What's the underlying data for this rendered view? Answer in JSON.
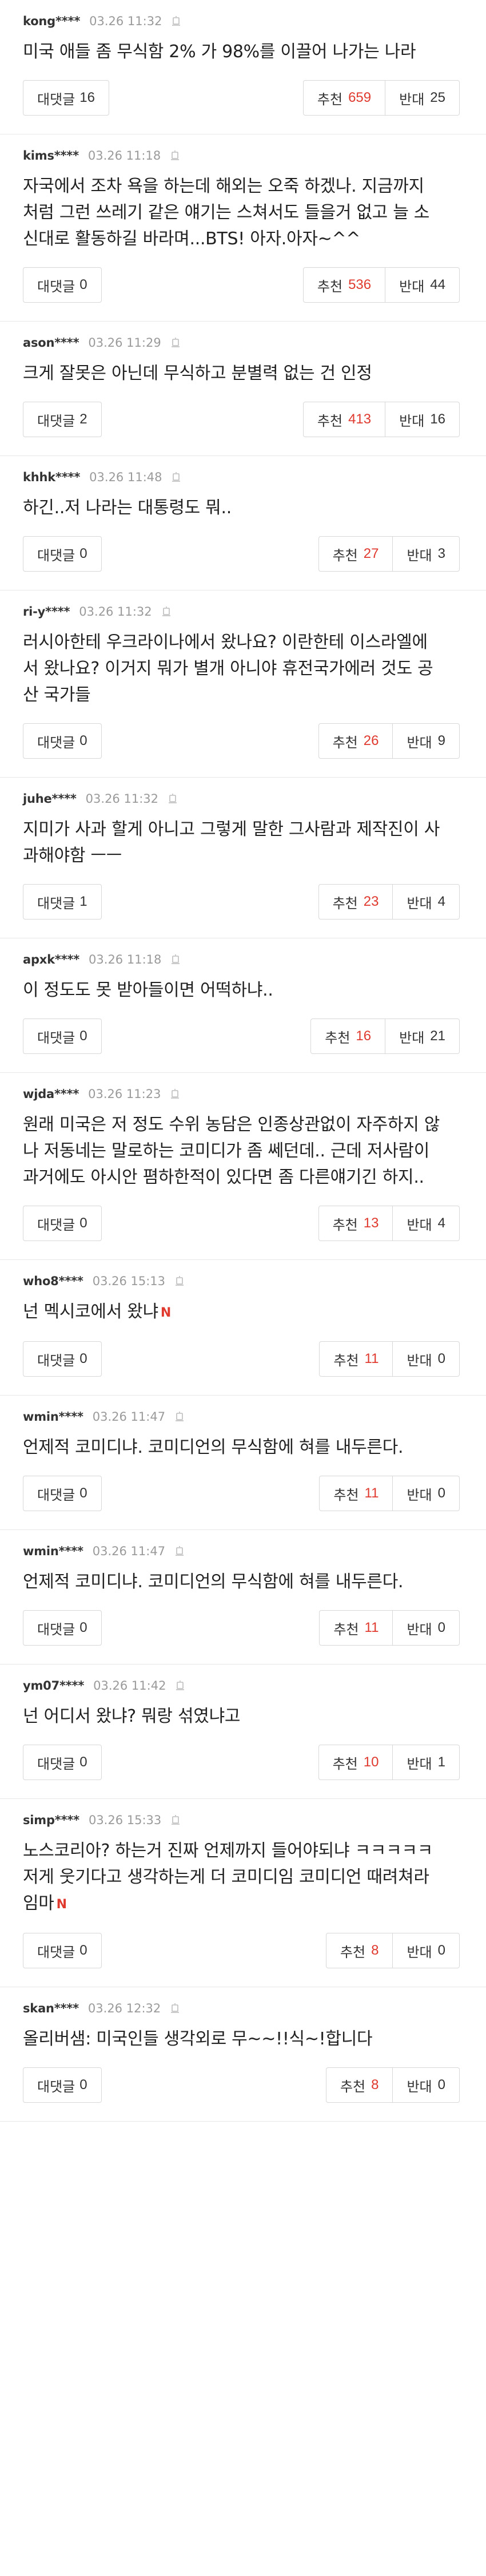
{
  "labels": {
    "reply": "대댓글",
    "up": "추천",
    "down": "반대"
  },
  "comments": [
    {
      "user": "kong****",
      "date": "03.26 11:32",
      "lines": [
        "미국 애들 좀 무식함 2% 가 98%를 이끌어 나가는 나라"
      ],
      "replies": "16",
      "up": "659",
      "down": "25"
    },
    {
      "user": "kims****",
      "date": "03.26 11:18",
      "lines": [
        "자국에서 조차 욕을 하는데 해외는 오죽 하겠나. 지금까지",
        "처럼 그런 쓰레기 같은 얘기는 스쳐서도 들을거 없고 늘 소",
        "신대로 활동하길 바라며...BTS! 아자.아자~^^"
      ],
      "replies": "0",
      "up": "536",
      "down": "44"
    },
    {
      "user": "ason****",
      "date": "03.26 11:29",
      "lines": [
        "크게 잘못은 아닌데 무식하고 분별력 없는 건 인정"
      ],
      "replies": "2",
      "up": "413",
      "down": "16"
    },
    {
      "user": "khhk****",
      "date": "03.26 11:48",
      "lines": [
        "하긴..저 나라는 대통령도 뭐.."
      ],
      "replies": "0",
      "up": "27",
      "down": "3"
    },
    {
      "user": "ri-y****",
      "date": "03.26 11:32",
      "lines": [
        "러시아한테 우크라이나에서 왔나요? 이란한테 이스라엘에",
        "서 왔나요? 이거지 뭐가 별개 아니야 휴전국가에러 것도 공",
        "산 국가들"
      ],
      "replies": "0",
      "up": "26",
      "down": "9"
    },
    {
      "user": "juhe****",
      "date": "03.26 11:32",
      "lines": [
        "지미가 사과 할게 아니고 그렇게 말한 그사람과 제작진이 사",
        "과해야함 ㅡㅡ"
      ],
      "replies": "1",
      "up": "23",
      "down": "4"
    },
    {
      "user": "apxk****",
      "date": "03.26 11:18",
      "lines": [
        "이 정도도 못 받아들이면 어떡하냐.."
      ],
      "replies": "0",
      "up": "16",
      "down": "21"
    },
    {
      "user": "wjda****",
      "date": "03.26 11:23",
      "lines": [
        "원래 미국은 저 정도 수위 농담은 인종상관없이 자주하지 않",
        "나 저동네는 말로하는 코미디가 좀 쎄던데.. 근데 저사람이",
        "과거에도 아시안 폄하한적이 있다면 좀 다른얘기긴 하지.."
      ],
      "replies": "0",
      "up": "13",
      "down": "4"
    },
    {
      "user": "who8****",
      "date": "03.26 15:13",
      "lines": [
        "넌 멕시코에서 왔냐"
      ],
      "badge": "N",
      "replies": "0",
      "up": "11",
      "down": "0"
    },
    {
      "user": "wmin****",
      "date": "03.26 11:47",
      "lines": [
        "언제적 코미디냐. 코미디언의 무식함에 혀를 내두른다."
      ],
      "replies": "0",
      "up": "11",
      "down": "0"
    },
    {
      "user": "wmin****",
      "date": "03.26 11:47",
      "lines": [
        "언제적 코미디냐. 코미디언의 무식함에 혀를 내두른다."
      ],
      "replies": "0",
      "up": "11",
      "down": "0"
    },
    {
      "user": "ym07****",
      "date": "03.26 11:42",
      "lines": [
        "넌 어디서 왔냐? 뭐랑 섞였냐고"
      ],
      "replies": "0",
      "up": "10",
      "down": "1"
    },
    {
      "user": "simp****",
      "date": "03.26 15:33",
      "lines": [
        "노스코리아? 하는거 진짜 언제까지 들어야되냐 ㅋㅋㅋㅋㅋ",
        "저게 웃기다고 생각하는게 더 코미디임 코미디언 때려쳐라",
        "임마"
      ],
      "badge": "N",
      "replies": "0",
      "up": "8",
      "down": "0"
    },
    {
      "user": "skan****",
      "date": "03.26 12:32",
      "lines": [
        "올리버샘: 미국인들 생각외로 무~~!!식~!합니다"
      ],
      "replies": "0",
      "up": "8",
      "down": "0"
    }
  ]
}
